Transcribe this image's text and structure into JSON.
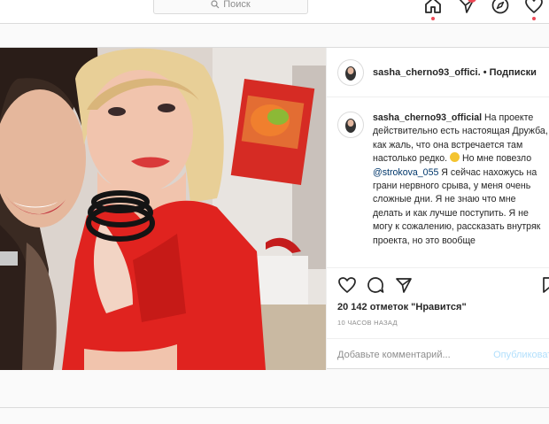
{
  "topbar": {
    "search_placeholder": "Поиск",
    "icons": [
      "home-icon",
      "direct-icon",
      "explore-icon",
      "activity-icon"
    ]
  },
  "post": {
    "username": "sasha_cherno93_offici.",
    "separator": " • ",
    "follow_label": "Подписки",
    "caption": {
      "username": "sasha_cherno93_official",
      "part1": " На проекте действительно есть настоящая Дружба, как жаль, что она встречается там настолько редко. ",
      "part2": " Но мне повезло ",
      "mention": "@strokova_055",
      "part3": " Я сейчас нахожусь на грани нервного срыва, у меня очень сложные дни. Я не знаю что мне делать и как лучше поступить. Я не могу к сожалению, рассказать внутряк проекта, но это вообще"
    },
    "likes": "20 142 отметок \"Нравится\"",
    "time": "10 ЧАСОВ НАЗАД",
    "comment_placeholder": "Добавьте комментарий...",
    "publish_label": "Опубликовать"
  },
  "colors": {
    "red_jacket": "#e0231f",
    "accent_blue": "#0095f6",
    "link_blue": "#00376b"
  }
}
